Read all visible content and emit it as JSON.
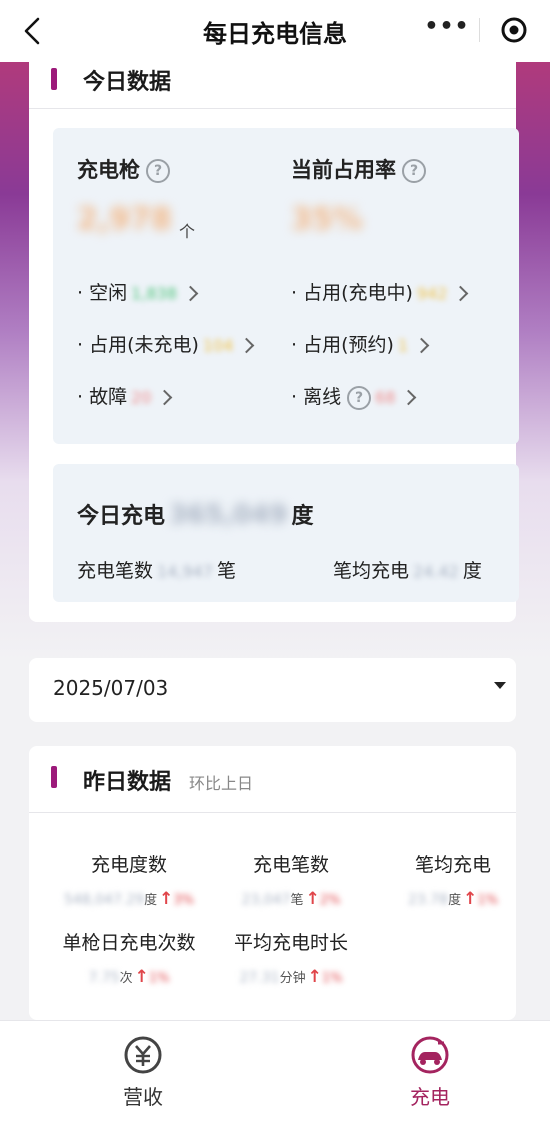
{
  "header": {
    "title": "每日充电信息",
    "more_icon": "more-dots-icon",
    "target_icon": "target-icon"
  },
  "today": {
    "section_title": "今日数据",
    "guns": {
      "title": "充电枪",
      "value": "2,978",
      "unit": "个",
      "items": [
        {
          "label": "· 空闲",
          "value": "1,838",
          "color": "#4cc47a"
        },
        {
          "label": "· 占用(未充电)",
          "value": "104",
          "color": "#f0c24a"
        },
        {
          "label": "· 故障",
          "value": "20",
          "color": "#f08a8a"
        }
      ]
    },
    "occupancy": {
      "title": "当前占用率",
      "value": "35%",
      "items": [
        {
          "label": "· 占用(充电中)",
          "value": "942",
          "color": "#f0c24a"
        },
        {
          "label": "· 占用(预约)",
          "value": "1",
          "color": "#f0c24a"
        },
        {
          "label": "· 离线",
          "value": "68",
          "color": "#f08a8a"
        }
      ]
    },
    "charge": {
      "label": "今日充电",
      "value": "365,049",
      "unit": "度",
      "count_label": "充电笔数",
      "count_value": "14,947",
      "count_unit": "笔",
      "avg_label": "笔均充电",
      "avg_value": "24.42",
      "avg_unit": "度"
    }
  },
  "date_picker": {
    "value": "2025/07/03"
  },
  "yesterday": {
    "section_title": "昨日数据",
    "note": "环比上日",
    "metrics": [
      {
        "label": "充电度数",
        "value": "548,047.29",
        "unit": "度",
        "pct": "3%"
      },
      {
        "label": "充电笔数",
        "value": "23,047",
        "unit": "笔",
        "pct": "2%"
      },
      {
        "label": "笔均充电",
        "value": "23.78",
        "unit": "度",
        "pct": "1%"
      },
      {
        "label": "单枪日充电次数",
        "value": "7.75",
        "unit": "次",
        "pct": "1%"
      },
      {
        "label": "平均充电时长",
        "value": "27.31",
        "unit": "分钟",
        "pct": "1%"
      }
    ]
  },
  "tabbar": {
    "items": [
      {
        "label": "营收",
        "icon": "yuan-icon"
      },
      {
        "label": "充电",
        "icon": "ev-charging-icon"
      }
    ],
    "active_color": "#a4245f"
  },
  "colors": {
    "accent": "#9c1a7a",
    "arrow_up": "#e0454a"
  }
}
